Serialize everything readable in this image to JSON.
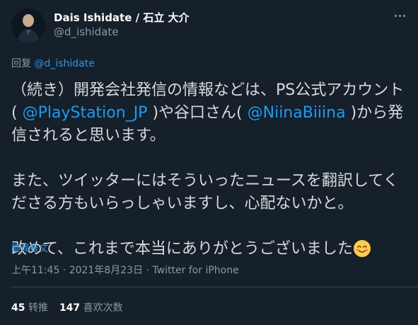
{
  "tweet": {
    "author_name": "Dais Ishidate / 石立 大介",
    "author_handle": "@d_ishidate",
    "more_icon": "more-icon",
    "reply_prefix": "回复",
    "reply_handle": "@d_ishidate",
    "p1": {
      "t1": "（続き）開発会社発信の情報などは、PS公式アカウント(",
      "m1": "@PlayStation_JP",
      "t2": ")や谷口さん(",
      "m2": "@NiinaBiiina",
      "t3": ")から発信されると思います。"
    },
    "p2": "また、ツイッターにはそういったニュースを翻訳してくださる方もいらっしゃいますし、心配ないかと。",
    "p3": "改めて、これまで本当にありがとうございました",
    "emoji": "smiling-face-icon",
    "translate_label": "翻译推文",
    "meta": "上午11:45 · 2021年8月23日 · Twitter for iPhone",
    "retweets_count": "45",
    "retweets_label": "转推",
    "likes_count": "147",
    "likes_label": "喜欢次数"
  },
  "colors": {
    "background": "#15202b",
    "text": "#d9d9d9",
    "secondary": "#8b98a5",
    "link": "#1d9bf0"
  }
}
